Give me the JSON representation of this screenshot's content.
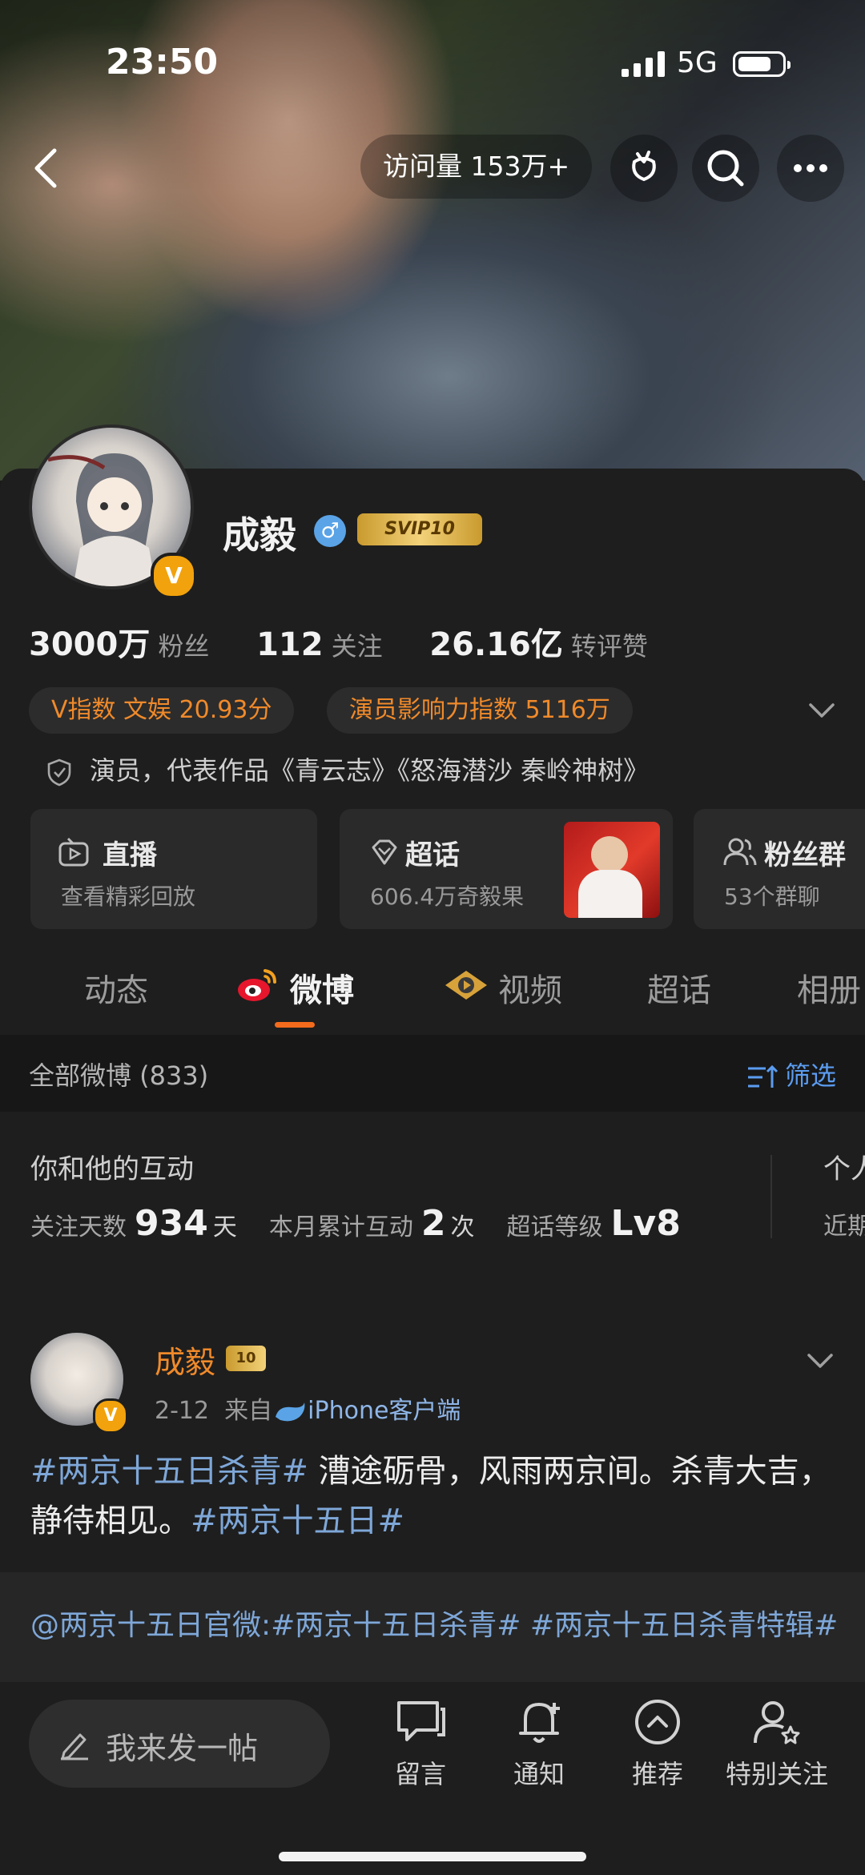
{
  "status_bar": {
    "time": "23:50",
    "network": "5G"
  },
  "header": {
    "visits": "访问量 153万+"
  },
  "profile": {
    "name": "成毅",
    "svip": "SVIP10",
    "badge_letter": "V",
    "stats": [
      {
        "num": "3000万",
        "label": "粉丝"
      },
      {
        "num": "112",
        "label": "关注"
      },
      {
        "num": "26.16亿",
        "label": "转评赞"
      }
    ],
    "pills": [
      "V指数 文娱 20.93分",
      "演员影响力指数 5116万"
    ],
    "bio": "演员，代表作品《青云志》《怒海潜沙 秦岭神树》"
  },
  "cards": [
    {
      "title": "直播",
      "sub": "查看精彩回放"
    },
    {
      "title": "超话",
      "sub": "606.4万奇毅果"
    },
    {
      "title": "粉丝群",
      "sub": "53个群聊"
    }
  ],
  "tabs": [
    "动态",
    "微博",
    "视频",
    "超话",
    "相册"
  ],
  "feed_header": {
    "all": "全部微博 (833)",
    "filter": "筛选"
  },
  "interaction": {
    "title": "你和他的互动",
    "follow_days_label": "关注天数",
    "follow_days": "934",
    "follow_days_unit": "天",
    "monthly_label": "本月累计互动",
    "monthly": "2",
    "monthly_unit": "次",
    "level_label": "超话等级",
    "level": "Lv8",
    "more_title": "个人",
    "more_sub": "近期"
  },
  "post": {
    "author": "成毅",
    "date": "2-12",
    "from": "来自",
    "source": "iPhone客户端",
    "tag1": "#两京十五日杀青#",
    "text1": " 漕途砺骨，风雨两京间。杀青大吉，静待相见。",
    "tag2": "#两京十五日#",
    "repost": "@两京十五日官微:#两京十五日杀青# #两京十五日杀青特辑#"
  },
  "bottom": {
    "compose": "我来发一帖",
    "items": [
      "留言",
      "通知",
      "推荐",
      "特别关注"
    ]
  },
  "colors": {
    "accent": "#f36b1c",
    "link": "#7ea7d8",
    "orange_text": "#f08a2a"
  }
}
